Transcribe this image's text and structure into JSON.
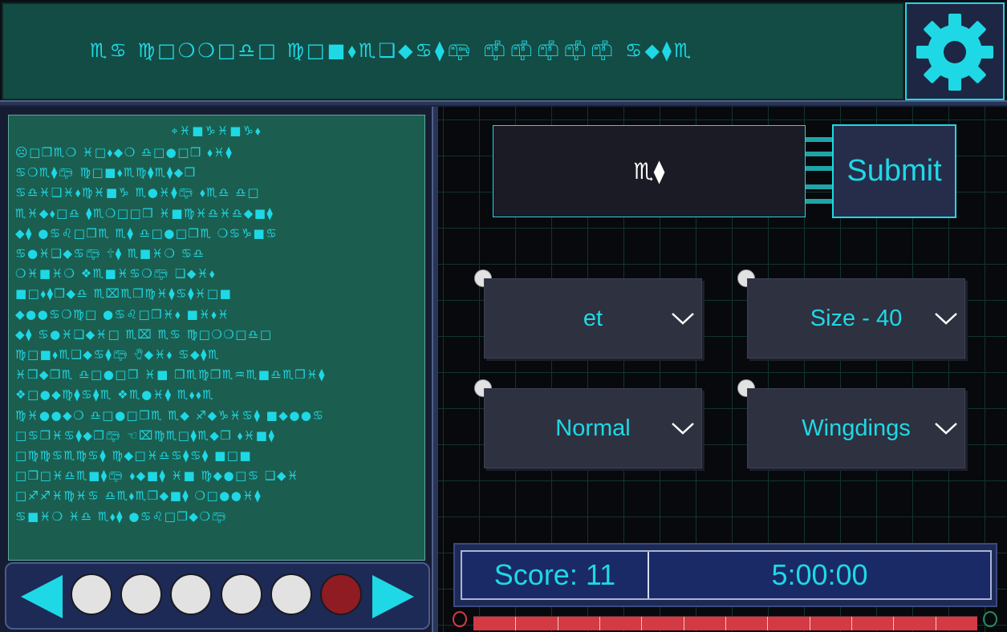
{
  "header": {
    "cipher_text": "♏︎♋︎ ♍︎□︎❍︎❍︎□︎♎︎□︎ ♍︎□︎■︎⬧︎♏︎❑︎◆︎♋︎⧫︎📪︎ 📫︎📫︎📫︎📫︎📫︎ ♋︎◆︎⧫︎♏︎"
  },
  "settings": {
    "icon": "gear-icon"
  },
  "text_panel": {
    "title": "⌖︎♓︎■︎♑︎♓︎■︎♑︎⬧︎",
    "lines": [
      "☹︎□︎❒︎♏︎❍︎ ♓︎□︎⬧︎◆︎❍︎ ♎︎□︎●︎□︎❒︎ ⬧︎♓︎⧫︎",
      "♋︎❍︎♏︎⧫︎📪︎ ♍︎□︎■︎⬧︎♏︎♍︎⧫︎♏︎⧫︎◆︎❒︎",
      "♋︎♎︎♓︎❑︎♓︎⬧︎♍︎♓︎■︎♑︎ ♏︎●︎♓︎⧫︎📪︎ ⬧︎♏︎♎︎ ♎︎□︎",
      "♏︎♓︎◆︎⬧︎□︎♎︎ ⧫︎♏︎❍︎□︎□︎❒︎ ♓︎■︎♍︎♓︎♎︎♓︎♎︎◆︎■︎⧫︎",
      "◆︎⧫︎ ●︎♋︎♌︎□︎❒︎♏︎ ♏︎⧫︎ ♎︎□︎●︎□︎❒︎♏︎ ❍︎♋︎♑︎■︎♋︎",
      "♋︎●︎♓︎❑︎◆︎♋︎📪︎ 🕆︎⧫︎ ♏︎■︎♓︎❍︎ ♋︎♎︎",
      "❍︎♓︎■︎♓︎❍︎ ❖︎♏︎■︎♓︎♋︎❍︎📪︎ ❑︎◆︎♓︎⬧︎",
      "■︎□︎⬧︎⧫︎❒︎◆︎♎︎ ♏︎⌧︎♏︎❒︎♍︎♓︎⧫︎♋︎⧫︎♓︎□︎■︎",
      "◆︎●︎●︎♋︎❍︎♍︎□︎ ●︎♋︎♌︎□︎❒︎♓︎⬧︎ ■︎♓︎⬧︎♓︎",
      "◆︎⧫︎ ♋︎●︎♓︎❑︎◆︎♓︎□︎ ♏︎⌧︎ ♏︎♋︎ ♍︎□︎❍︎❍︎□︎♎︎□︎",
      "♍︎□︎■︎⬧︎♏︎❑︎◆︎♋︎⧫︎📪︎ 🖐︎◆︎♓︎⬧︎ ♋︎◆︎⧫︎♏︎",
      "♓︎❒︎◆︎❒︎♏︎ ♎︎□︎●︎□︎❒︎ ♓︎■︎ ❒︎♏︎♍︎❒︎♏︎♒︎♏︎■︎♎︎♏︎❒︎♓︎⧫︎",
      "❖︎□︎●︎◆︎♍︎⧫︎♋︎⧫︎♏︎ ❖︎♏︎●︎♓︎⧫︎ ♏︎⬧︎⬧︎♏︎",
      "♍︎♓︎●︎●︎◆︎❍︎ ♎︎□︎●︎□︎❒︎♏︎ ♏︎◆︎ ♐︎◆︎♑︎♓︎♋︎⧫︎ ■︎◆︎●︎●︎♋︎",
      "□︎♋︎❒︎♓︎♋︎⧫︎◆︎❒︎📪︎ ☜︎⌧︎♍︎♏︎□︎⧫︎♏︎◆︎❒︎ ⬧︎♓︎■︎⧫︎",
      "□︎♍︎♍︎♋︎♏︎♍︎♋︎⧫︎ ♍︎◆︎□︎♓︎♎︎♋︎⧫︎♋︎⧫︎ ■︎□︎■︎",
      "□︎❒︎□︎♓︎♎︎♏︎■︎⧫︎📪︎ ⬧︎◆︎■︎⧫︎ ♓︎■︎ ♍︎◆︎●︎□︎♋︎ ❑︎◆︎♓︎",
      "□︎♐︎♐︎♓︎♍︎♓︎♋︎ ♎︎♏︎⬧︎♏︎❒︎◆︎■︎⧫︎ ❍︎□︎●︎●︎♓︎⧫︎",
      "♋︎■︎♓︎❍︎ ♓︎♎︎ ♏︎⬧︎⧫︎ ●︎♋︎♌︎□︎❒︎◆︎❍︎📪︎"
    ]
  },
  "nav": {
    "prev_icon": "left-arrow-icon",
    "next_icon": "right-arrow-icon",
    "pages": [
      {
        "active": false
      },
      {
        "active": false
      },
      {
        "active": false
      },
      {
        "active": false
      },
      {
        "active": false
      },
      {
        "active": true
      }
    ]
  },
  "answer": {
    "value": "♏︎⧫︎"
  },
  "submit": {
    "label": "Submit"
  },
  "dropdowns": {
    "word": "et",
    "size": "Size - 40",
    "style": "Normal",
    "font": "Wingdings"
  },
  "score": {
    "label": "Score: 11"
  },
  "timer": {
    "value": "5:00:00"
  },
  "progress": {
    "fraction": 1.0,
    "segments": 12
  },
  "colors": {
    "accent": "#1fd8e6",
    "panel": "#1b5e50",
    "active_dot": "#8f1c22",
    "progress": "#d33a44"
  }
}
